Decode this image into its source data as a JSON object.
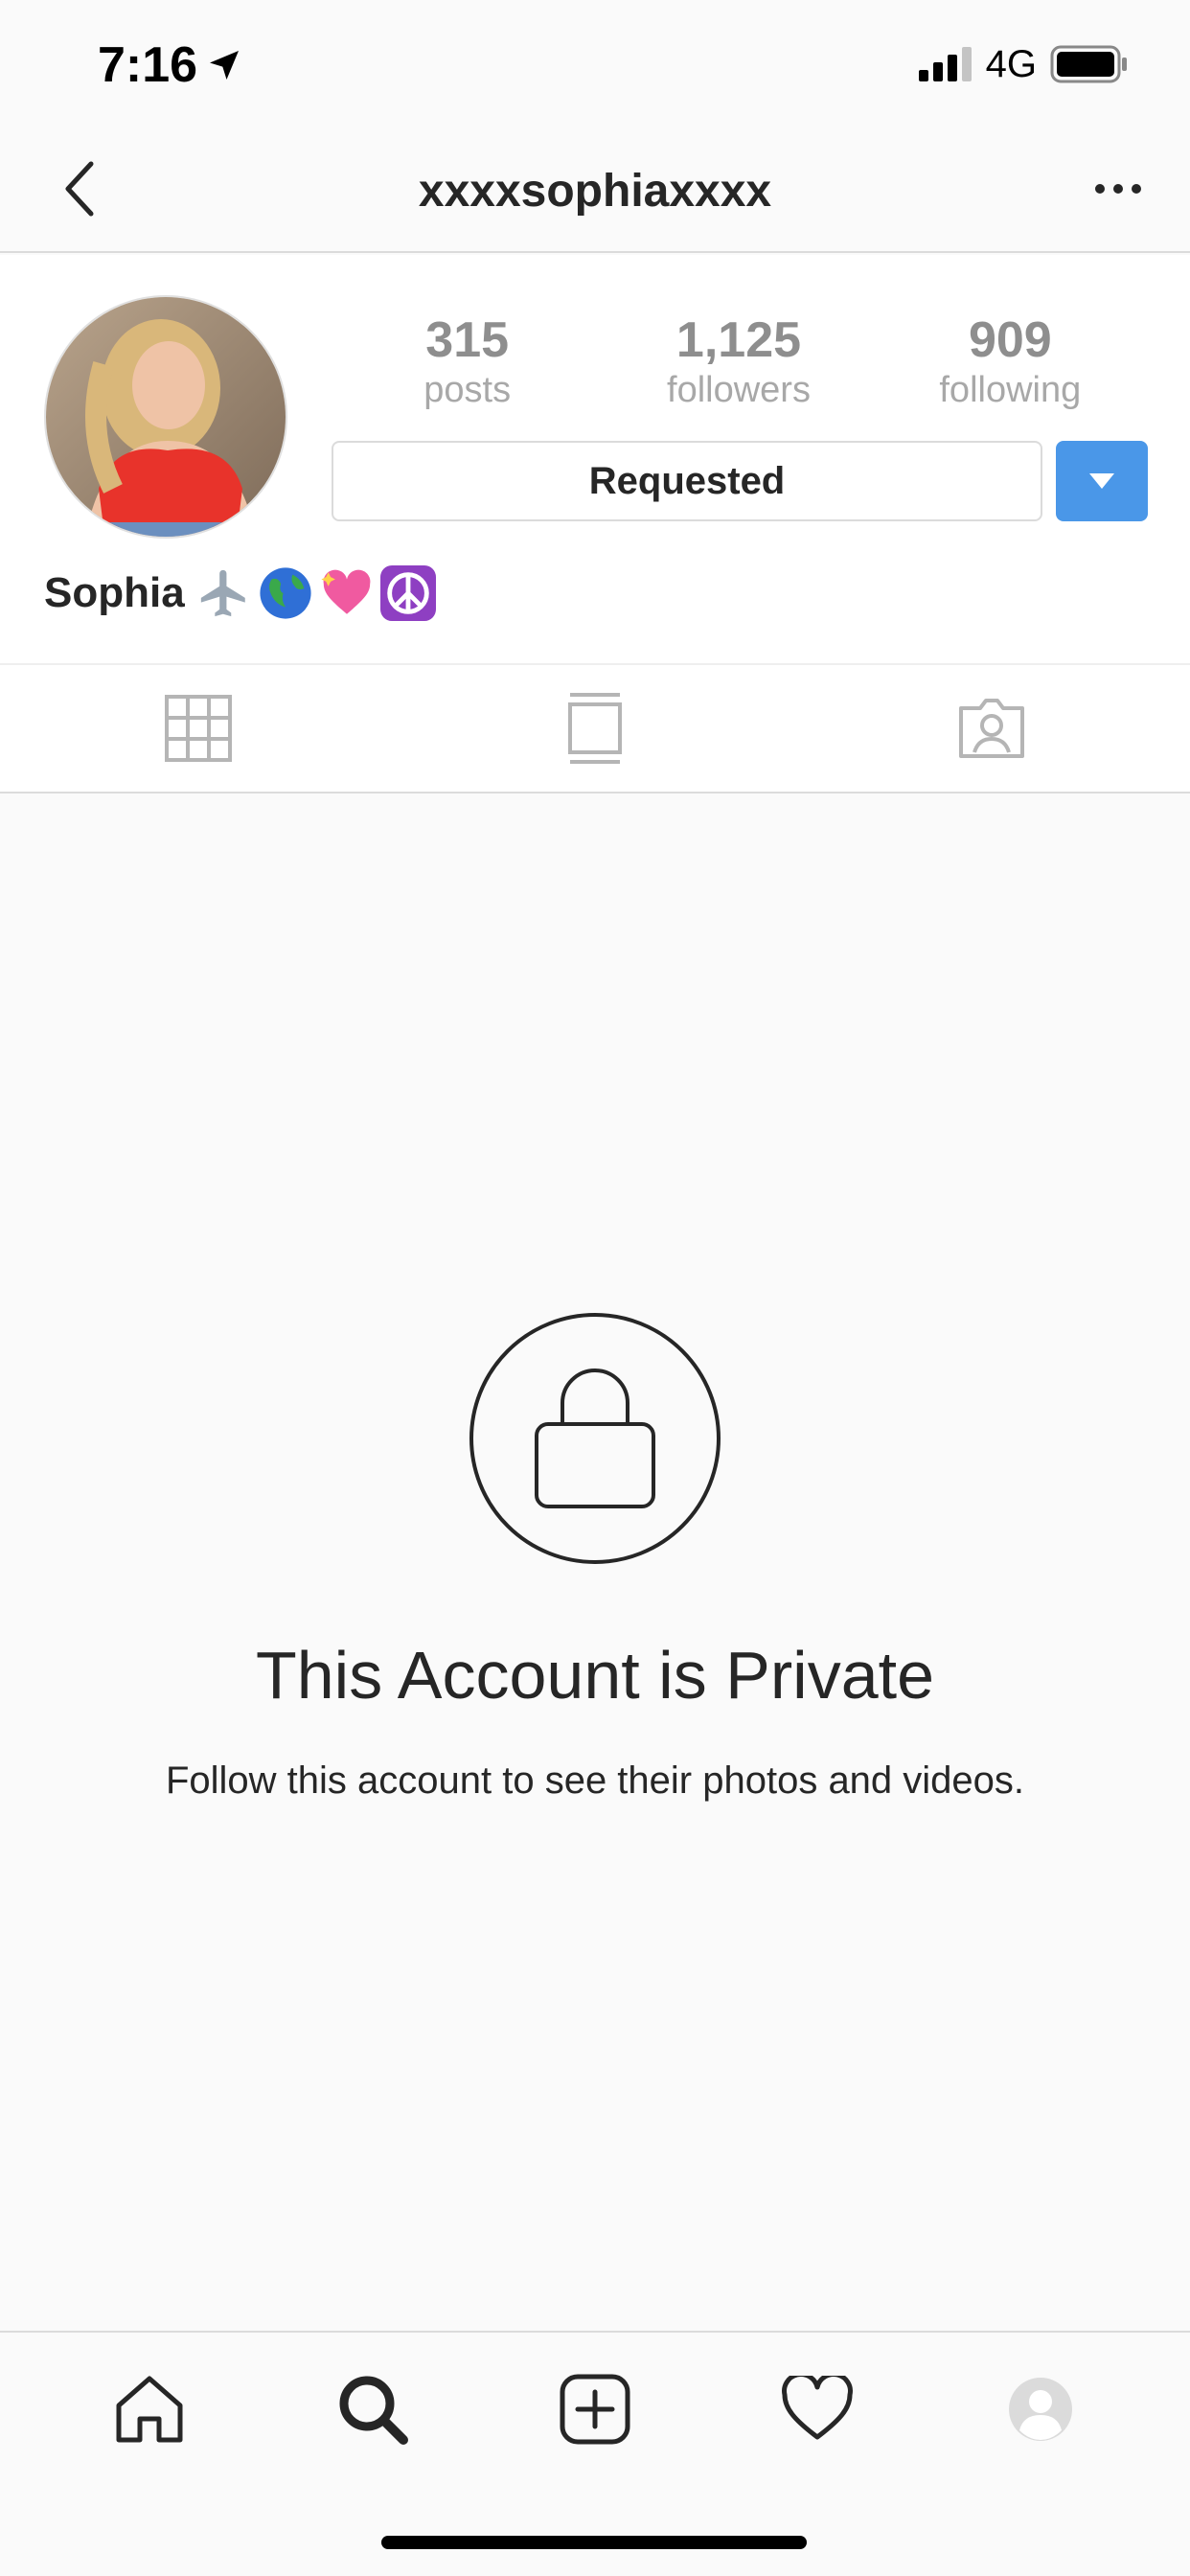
{
  "status": {
    "time": "7:16",
    "network": "4G"
  },
  "header": {
    "username": "xxxxsophiaxxxx"
  },
  "profile": {
    "stats": [
      {
        "count": "315",
        "label": "posts"
      },
      {
        "count": "1,125",
        "label": "followers"
      },
      {
        "count": "909",
        "label": "following"
      }
    ],
    "requested_label": "Requested",
    "display_name": "Sophia",
    "emojis": [
      "✈️",
      "🌎",
      "💖",
      "☮️"
    ]
  },
  "private": {
    "title": "This Account is Private",
    "subtitle": "Follow this account to see their photos and videos."
  },
  "colors": {
    "accent": "#4a97e8",
    "text": "#262626",
    "muted": "#8e8e8e",
    "border": "#dbdbdb"
  },
  "icons": {
    "tabs": [
      "grid-icon",
      "feed-icon",
      "tagged-icon"
    ],
    "nav": [
      "home-icon",
      "search-icon",
      "new-post-icon",
      "activity-icon",
      "profile-icon"
    ]
  }
}
